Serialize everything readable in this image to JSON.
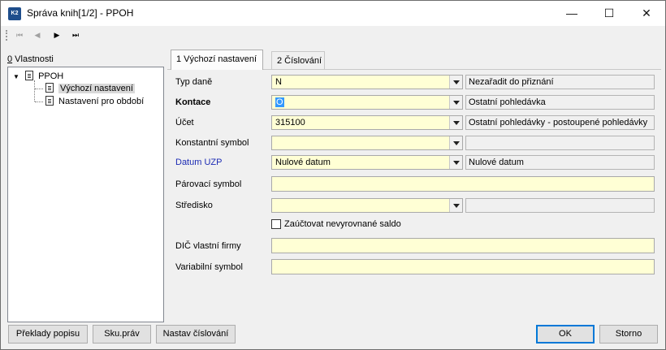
{
  "window": {
    "title": "Správa knih[1/2] - PPOH",
    "app_icon_text": "K2",
    "minimize_icon": "minimize-icon",
    "maximize_icon": "maximize-icon",
    "close_icon": "close-icon"
  },
  "toolbar": {
    "first": "⏮",
    "prev": "◀",
    "next": "▶",
    "last": "⏭"
  },
  "left": {
    "label_accel": "0",
    "label_rest": " Vlastnosti",
    "tree": {
      "root": "PPOH",
      "children": [
        "Výchozí nastavení",
        "Nastavení pro období"
      ],
      "selected": "Výchozí nastavení"
    }
  },
  "tabs": [
    {
      "label": "1 Výchozí nastavení",
      "active": true
    },
    {
      "label": "2 Číslování",
      "active": false
    }
  ],
  "form": {
    "typ_dane": {
      "label": "Typ daně",
      "value": "N",
      "desc": "Nezařadit do přiznání"
    },
    "kontace": {
      "label": "Kontace",
      "value": "O",
      "desc": "Ostatní pohledávka"
    },
    "ucet": {
      "label": "Účet",
      "value": "315100",
      "desc": "Ostatní pohledávky - postoupené pohledávky"
    },
    "konstantni_symbol": {
      "label": "Konstantní symbol",
      "value": "",
      "desc": ""
    },
    "datum_uzp": {
      "label": "Datum UZP",
      "value": "Nulové datum",
      "desc": "Nulové datum"
    },
    "parovaci_symbol": {
      "label": "Párovací symbol",
      "value": ""
    },
    "stredisko": {
      "label": "Středisko",
      "value": "",
      "desc": ""
    },
    "zauctovat": {
      "label": "Zaúčtovat nevyrovnané saldo",
      "checked": false
    },
    "dic": {
      "label": "DIČ vlastní firmy",
      "value": ""
    },
    "variabilni_symbol": {
      "label": "Variabilní symbol",
      "value": ""
    }
  },
  "buttons": {
    "preklady": "Překlady popisu",
    "sku": "Sku.práv",
    "nastav": "Nastav číslování",
    "ok": "OK",
    "storno": "Storno"
  },
  "colors": {
    "field_bg": "#ffffd5",
    "label_blue": "#1c2bb4",
    "selection": "#3399ff"
  }
}
